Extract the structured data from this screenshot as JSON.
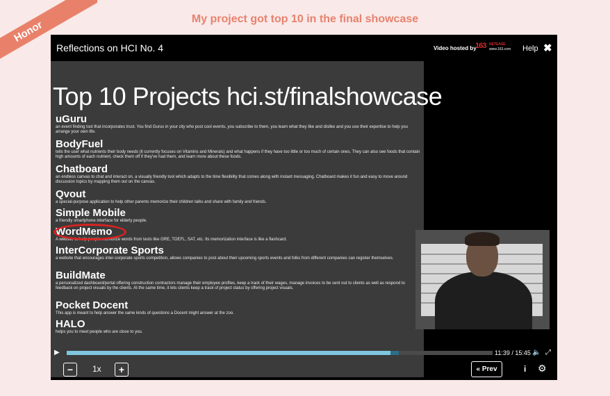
{
  "ribbon": "Honor",
  "headline": "My project got top 10 in the final showcase",
  "player": {
    "title": "Reflections on HCI No. 4",
    "hosted_by": "Video hosted by",
    "logo_number": "163",
    "logo_brand": "NETEASE",
    "logo_domain": "www.163.com",
    "help": "Help",
    "close": "✖"
  },
  "slide": {
    "title": "Top 10 Projects hci.st/finalshowcase",
    "projects": [
      {
        "name": "uGuru",
        "desc": "an event finding tool that incorporates trust. You find Gurus in your city who post cool events, you subscribe to them, you learn what they like and dislike and you use their expertise to help you arrange your own life."
      },
      {
        "name": "BodyFuel",
        "desc": "tells the user what nutrients their body needs (it currently focuses on Vitamins and Minerals) and what happens if they have too little or too much of certain ones. They can also see foods that contain high amounts of each nutrient, check them off if they've had them, and learn more about these foods."
      },
      {
        "name": "Chatboard",
        "desc": "an endless canvas to chat and interact on, a visually friendly tool which adapts to the time flexibility that comes along with instant messaging. Chatboard makes it fun and easy to move around discussion topics by mapping them out on the canvas."
      },
      {
        "name": "Qvout",
        "desc": "a special-purpose application to help other parents memorize their children talks and share with family and friends."
      },
      {
        "name": "Simple Mobile",
        "desc": "a friendly smartphone interface for elderly people."
      },
      {
        "name": "WordMemo",
        "desc": "A website to help people memorize words from tests like GRE, TOEFL, SAT, etc. Its memorization interface is like a flashcard."
      },
      {
        "name": "InterCorporate Sports",
        "desc": "a website that encourages inter-corporate sports competition, allows companies to post about their upcoming sports events and folks from different companies can register themselves."
      },
      {
        "name": "BuildMate",
        "desc": "a personalized dashboard/portal offering construction contractors manage their employee profiles, keep a track of their wages, manage invoices to be sent out to clients as well as respond to feedback on project visuals by the clients. At the same time, it lets clients keep a track of project status by offering project visuals."
      },
      {
        "name": "Pocket Docent",
        "desc": "This app is meant to help answer the same kinds of questions a Docent might answer at the zoo."
      },
      {
        "name": "HALO",
        "desc": "helps you to meet people who are close to you."
      }
    ]
  },
  "controls": {
    "play": "▶",
    "time": "11:39 / 15:45",
    "played_fraction": 0.76,
    "buffered_fraction": 0.78,
    "minus": "−",
    "speed": "1x",
    "plus": "+",
    "prev": "« Prev",
    "info": "i",
    "gear": "⚙",
    "volume": "🔈",
    "fullscreen": "⤢"
  },
  "colors": {
    "accent": "#e8826e",
    "highlight_circle": "#d8231f",
    "progress": "#7fc6df"
  }
}
